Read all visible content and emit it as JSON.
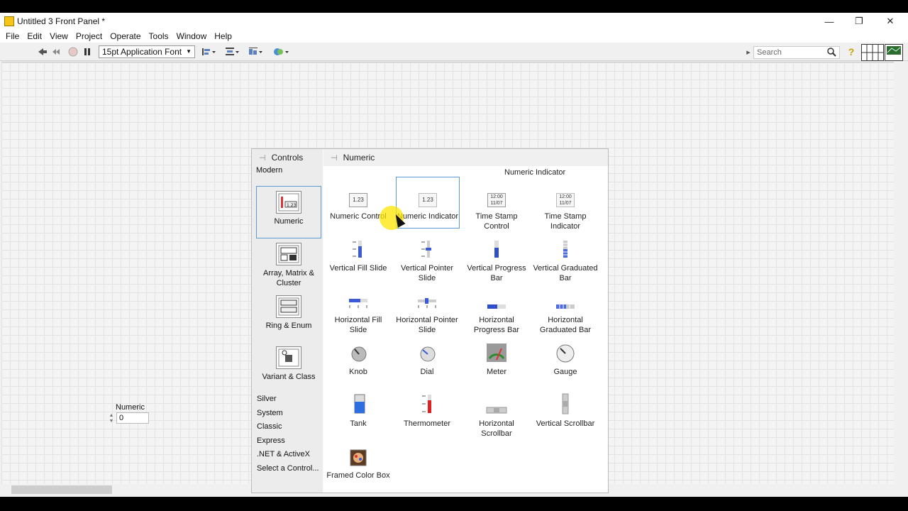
{
  "window": {
    "title": "Untitled 3 Front Panel *",
    "minimize_glyph": "—",
    "restore_glyph": "❐",
    "close_glyph": "✕"
  },
  "menu": [
    "File",
    "Edit",
    "View",
    "Project",
    "Operate",
    "Tools",
    "Window",
    "Help"
  ],
  "toolbar": {
    "font": "15pt Application Font",
    "search_placeholder": "Search",
    "help_glyph": "?"
  },
  "numeric_control": {
    "label": "Numeric",
    "value": "0"
  },
  "palette": {
    "left_title": "Controls",
    "right_title": "Numeric",
    "section": "Modern",
    "categories": [
      "Numeric",
      "Array, Matrix & Cluster",
      "Ring & Enum",
      "Variant & Class"
    ],
    "subcategories": [
      "Silver",
      "System",
      "Classic",
      "Express",
      ".NET & ActiveX",
      "Select a Control..."
    ],
    "tooltip": "Numeric Indicator",
    "items": [
      "Numeric Control",
      "Numeric Indicator",
      "Time Stamp Control",
      "Time Stamp Indicator",
      "Vertical Fill Slide",
      "Vertical Pointer Slide",
      "Vertical Progress Bar",
      "Vertical Graduated Bar",
      "Horizontal Fill Slide",
      "Horizontal Pointer Slide",
      "Horizontal Progress Bar",
      "Horizontal Graduated Bar",
      "Knob",
      "Dial",
      "Meter",
      "Gauge",
      "Tank",
      "Thermometer",
      "Horizontal Scrollbar",
      "Vertical Scrollbar",
      "Framed Color Box"
    ]
  }
}
